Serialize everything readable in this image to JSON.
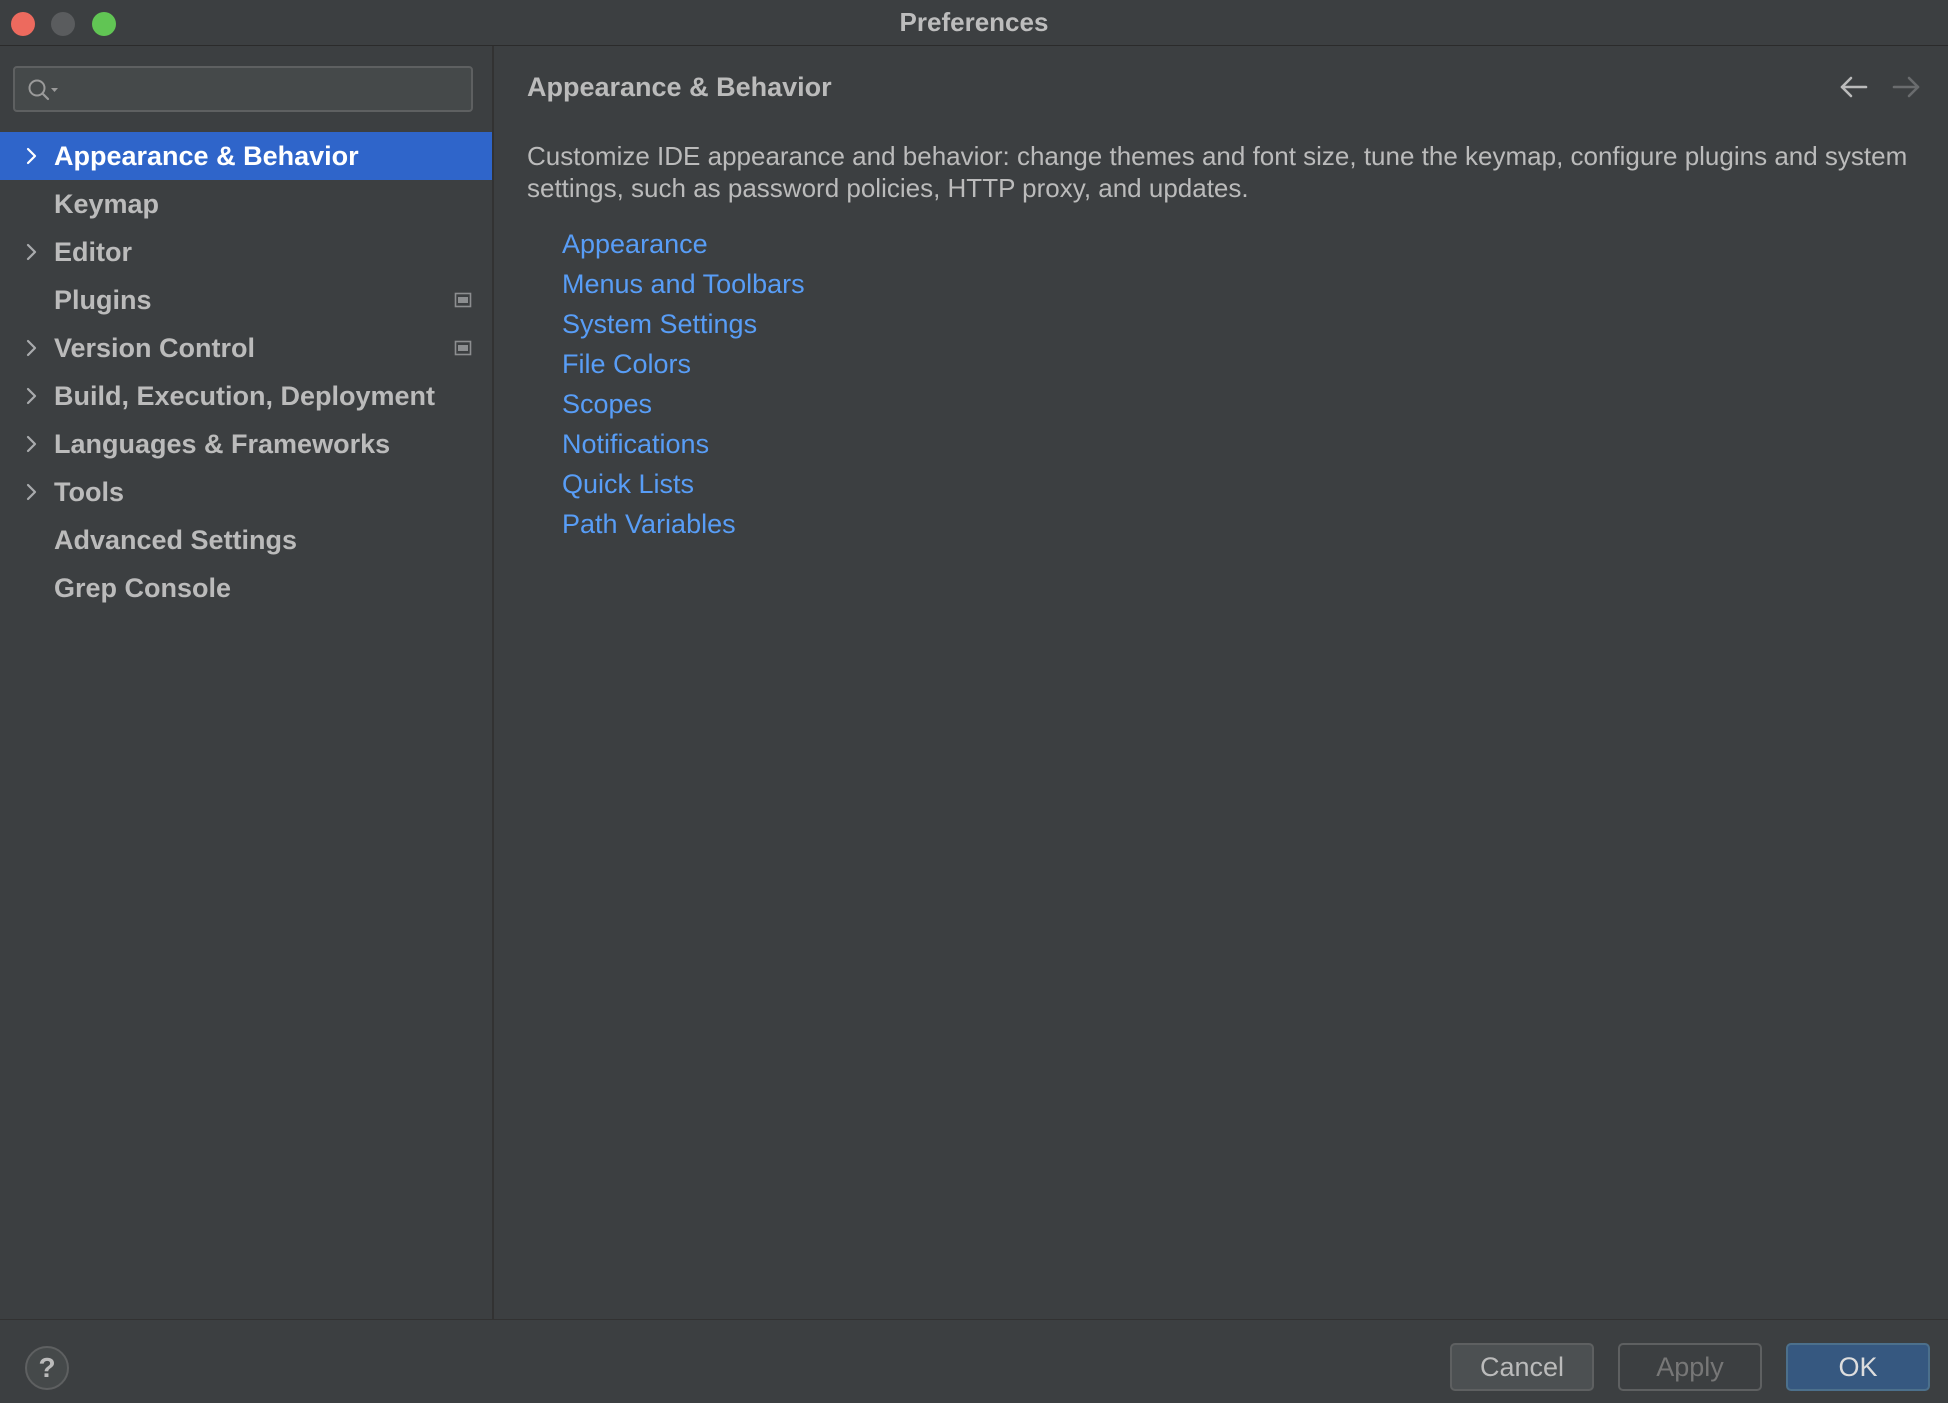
{
  "window": {
    "title": "Preferences"
  },
  "sidebar": {
    "search": {
      "value": "",
      "placeholder": ""
    },
    "items": [
      {
        "label": "Appearance & Behavior",
        "expandable": true,
        "selected": true,
        "project_icon": false
      },
      {
        "label": "Keymap",
        "expandable": false,
        "selected": false,
        "project_icon": false
      },
      {
        "label": "Editor",
        "expandable": true,
        "selected": false,
        "project_icon": false
      },
      {
        "label": "Plugins",
        "expandable": false,
        "selected": false,
        "project_icon": true
      },
      {
        "label": "Version Control",
        "expandable": true,
        "selected": false,
        "project_icon": true
      },
      {
        "label": "Build, Execution, Deployment",
        "expandable": true,
        "selected": false,
        "project_icon": false
      },
      {
        "label": "Languages & Frameworks",
        "expandable": true,
        "selected": false,
        "project_icon": false
      },
      {
        "label": "Tools",
        "expandable": true,
        "selected": false,
        "project_icon": false
      },
      {
        "label": "Advanced Settings",
        "expandable": false,
        "selected": false,
        "project_icon": false
      },
      {
        "label": "Grep Console",
        "expandable": false,
        "selected": false,
        "project_icon": false
      }
    ]
  },
  "main": {
    "title": "Appearance & Behavior",
    "description": "Customize IDE appearance and behavior: change themes and font size, tune the keymap, configure plugins and system settings, such as password policies, HTTP proxy, and updates.",
    "links": [
      "Appearance",
      "Menus and Toolbars",
      "System Settings",
      "File Colors",
      "Scopes",
      "Notifications",
      "Quick Lists",
      "Path Variables"
    ]
  },
  "footer": {
    "help_label": "?",
    "cancel_label": "Cancel",
    "apply_label": "Apply",
    "ok_label": "OK"
  },
  "colors": {
    "background": "#3c3f41",
    "selection": "#2f65ca",
    "link": "#589df6",
    "text": "#bbbbbb",
    "ok_button": "#365880"
  }
}
